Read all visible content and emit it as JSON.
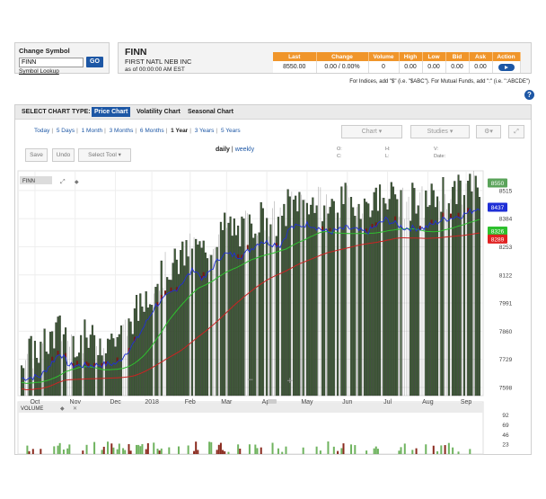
{
  "symbol_panel": {
    "title": "Change Symbol",
    "input_value": "FINN",
    "go_label": "GO",
    "lookup_label": "Symbol Lookup"
  },
  "quote": {
    "symbol": "FINN",
    "name": "FIRST NATL NEB INC",
    "timestamp": "as of 00:00:00 AM EST",
    "headers": [
      "Last",
      "Change",
      "Volume",
      "High",
      "Low",
      "Bid",
      "Ask",
      "Action"
    ],
    "values": [
      "8550.00",
      "0.00 / 0.00%",
      "0",
      "0.00",
      "0.00",
      "0.00",
      "0.00"
    ],
    "header_color": "#f0952a"
  },
  "hint_text": "For Indices, add \"$\" (i.e. \"$ABC\"). For Mutual Funds, add \":\" (i.e. \":ABCDE\")",
  "help_icon": "?",
  "chart_type_bar": {
    "label": "SELECT CHART TYPE:",
    "types": [
      "Price Chart",
      "Volatility Chart",
      "Seasonal Chart"
    ],
    "selected": "Price Chart"
  },
  "ranges": [
    "Today",
    "5 Days",
    "1 Month",
    "3 Months",
    "6 Months",
    "1 Year",
    "3 Years",
    "5 Years"
  ],
  "selected_range": "1 Year",
  "toolbar": {
    "chart_label": "Chart",
    "studies_label": "Studies",
    "save_label": "Save",
    "undo_label": "Undo",
    "select_tool_label": "Select Tool"
  },
  "period": {
    "daily": "daily",
    "sep": "|",
    "weekly": "weekly"
  },
  "ohlc_labels": {
    "o": "O:",
    "h": "H:",
    "c": "C:",
    "l": "L:",
    "v": "V:",
    "date": "Date:"
  },
  "chart_data": {
    "type": "bar",
    "symbol_label": "FINN",
    "x_labels": [
      "Oct",
      "Nov",
      "Dec",
      "2018",
      "Feb",
      "Mar",
      "Apr",
      "May",
      "Jun",
      "Jul",
      "Aug",
      "Sep"
    ],
    "y_ticks": [
      8515,
      8384,
      8253,
      8122,
      7991,
      7860,
      7729,
      7598
    ],
    "ylim": [
      7560,
      8590
    ],
    "price_tags": [
      {
        "value": 8550,
        "label": "8550",
        "color": "#5aa35a"
      },
      {
        "value": 8437,
        "label": "8437",
        "color": "#1f2fd6"
      },
      {
        "value": 8326,
        "label": "8326",
        "color": "#2ec02e"
      },
      {
        "value": 8289,
        "label": "8289",
        "color": "#e02222"
      }
    ],
    "volume_label": "VOLUME",
    "volume_ticks": [
      92,
      69,
      46,
      23
    ],
    "volume_ylim": [
      0,
      110
    ],
    "grid": true,
    "series_colors": {
      "price": "#1f2fd6",
      "ma_short": "#2ec02e",
      "ma_long": "#cc2222",
      "bar_fill": "#3d5a35",
      "volume_up": "#6fb35f",
      "volume_down": "#8a2a1e"
    }
  }
}
